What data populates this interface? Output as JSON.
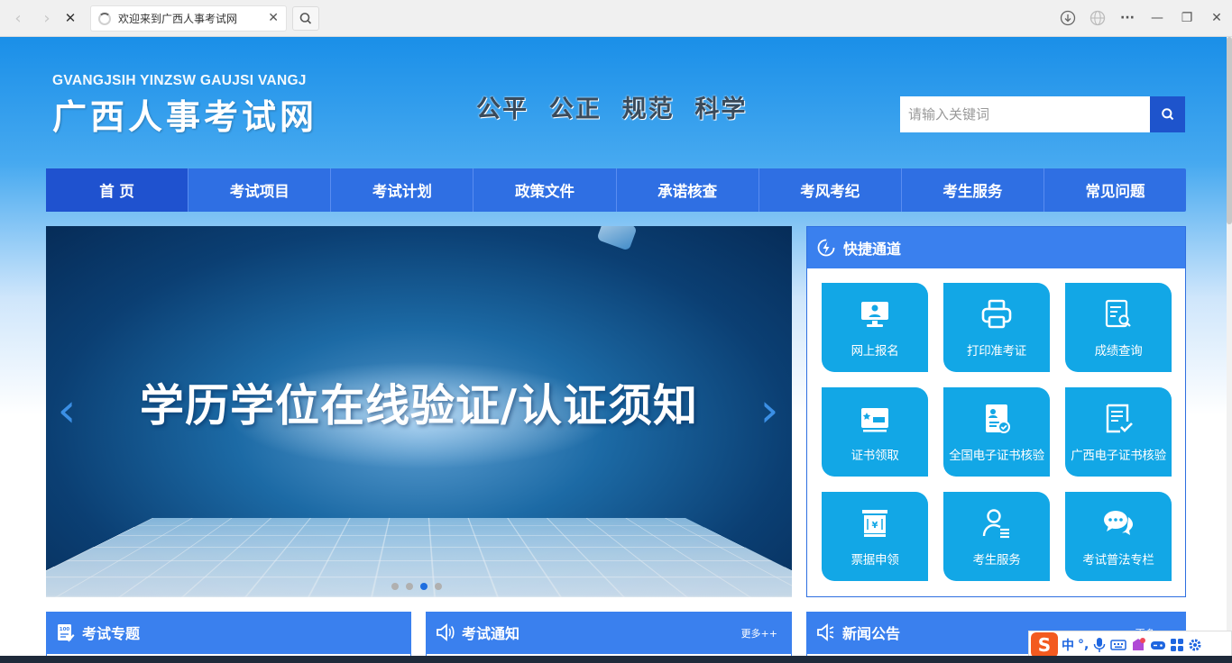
{
  "browser": {
    "tab_title": "欢迎来到广西人事考试网",
    "close_glyph": "✕",
    "back_glyph": "‹",
    "forward_glyph": "›",
    "stop_glyph": "✕",
    "menu_glyph": "···",
    "min_glyph": "—",
    "max_glyph": "❐",
    "winclose_glyph": "✕"
  },
  "header": {
    "logo_pinyin": "GVANGJSIH YINZSW GAUJSI VANGJ",
    "logo_cn": "广西人事考试网",
    "slogan": "公平  公正  规范  科学",
    "search_placeholder": "请输入关键词"
  },
  "nav": {
    "items": [
      "首 页",
      "考试项目",
      "考试计划",
      "政策文件",
      "承诺核查",
      "考风考纪",
      "考生服务",
      "常见问题"
    ]
  },
  "banner": {
    "title": "学历学位在线验证/认证须知",
    "prev_glyph": "‹",
    "next_glyph": "›",
    "slides_total": 4,
    "active_slide": 3
  },
  "quick": {
    "title": "快捷通道",
    "items": [
      {
        "label": "网上报名",
        "icon": "monitor-icon"
      },
      {
        "label": "打印准考证",
        "icon": "printer-icon"
      },
      {
        "label": "成绩查询",
        "icon": "score-search-icon"
      },
      {
        "label": "证书领取",
        "icon": "certificate-icon"
      },
      {
        "label": "全国电子证书核验",
        "icon": "id-card-check-icon"
      },
      {
        "label": "广西电子证书核验",
        "icon": "document-check-icon"
      },
      {
        "label": "票据申领",
        "icon": "receipt-icon"
      },
      {
        "label": "考生服务",
        "icon": "user-list-icon"
      },
      {
        "label": "考试普法专栏",
        "icon": "chat-bubbles-icon"
      }
    ]
  },
  "panels": {
    "topics": {
      "title": "考试专题"
    },
    "notices": {
      "title": "考试通知",
      "more": "更多++"
    },
    "news": {
      "title": "新闻公告",
      "more": "更多++"
    }
  },
  "ime": {
    "logo": "S",
    "mode": "中",
    "punct": "°,"
  },
  "colors": {
    "nav_blue": "#2f6fe3",
    "nav_active": "#1f52cf",
    "tile_cyan": "#12a7e6",
    "header_blue": "#3a80ee",
    "search_btn": "#1e54cc"
  }
}
